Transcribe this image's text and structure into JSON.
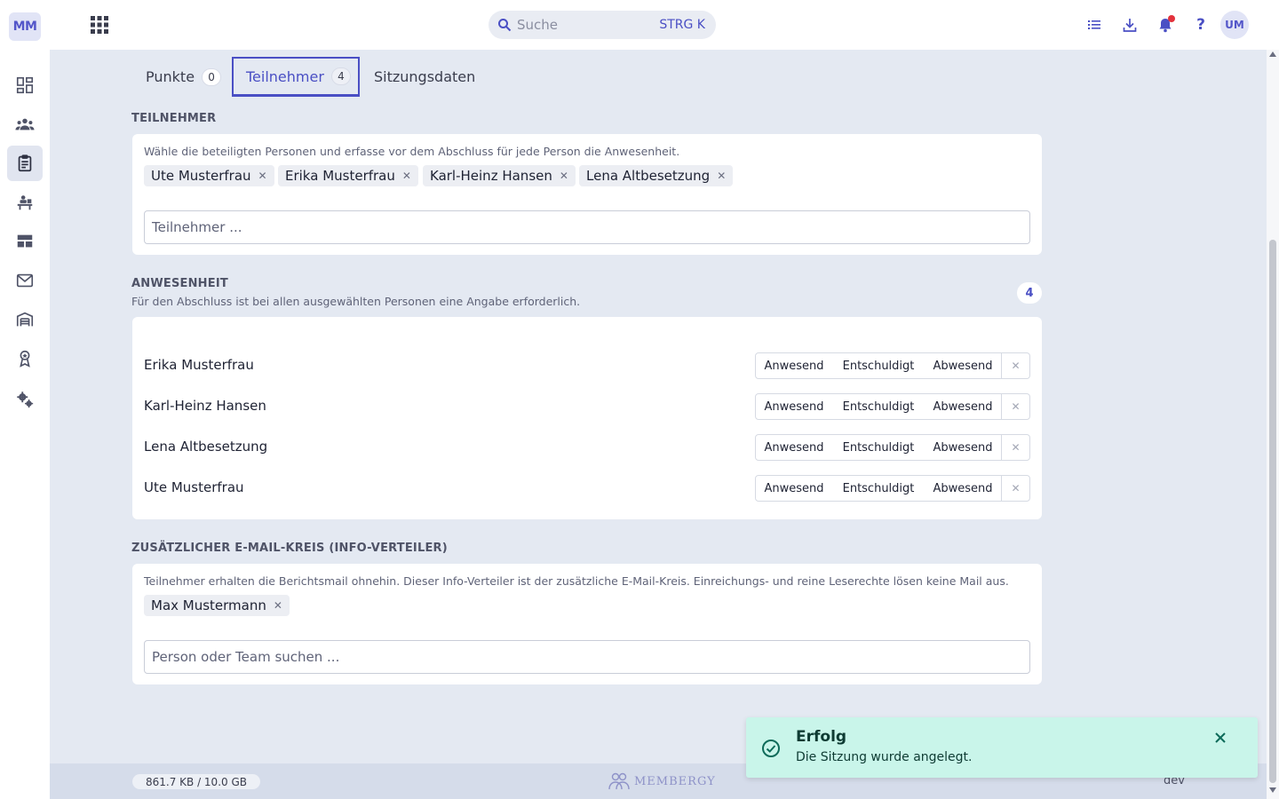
{
  "brand": {
    "initials": "MM"
  },
  "sidebar": {
    "items": [
      {
        "icon": "dashboard-icon"
      },
      {
        "icon": "people-icon"
      },
      {
        "icon": "clipboard-icon",
        "active": true
      },
      {
        "icon": "meeting-icon"
      },
      {
        "icon": "table-icon"
      },
      {
        "icon": "mail-icon"
      },
      {
        "icon": "warehouse-icon"
      },
      {
        "icon": "award-icon"
      },
      {
        "icon": "settings-icon"
      }
    ]
  },
  "topbar": {
    "search_placeholder": "Suche",
    "search_shortcut": "STRG K",
    "help_label": "?",
    "avatar_initials": "UM"
  },
  "tabs": [
    {
      "label": "Punkte",
      "count": "0"
    },
    {
      "label": "Teilnehmer",
      "count": "4",
      "active": true
    },
    {
      "label": "Sitzungsdaten"
    }
  ],
  "participants": {
    "title": "TEILNEHMER",
    "hint": "Wähle die beteiligten Personen und erfasse vor dem Abschluss für jede Person die Anwesenheit.",
    "chips": [
      "Ute Musterfrau",
      "Erika Musterfrau",
      "Karl-Heinz Hansen",
      "Lena Altbesetzung"
    ],
    "input_placeholder": "Teilnehmer ..."
  },
  "attendance": {
    "title": "ANWESENHEIT",
    "subtitle": "Für den Abschluss ist bei allen ausgewählten Personen eine Angabe erforderlich.",
    "count": "4",
    "options": [
      "Anwesend",
      "Entschuldigt",
      "Abwesend"
    ],
    "people": [
      "Erika Musterfrau",
      "Karl-Heinz Hansen",
      "Lena Altbesetzung",
      "Ute Musterfrau"
    ]
  },
  "mailing": {
    "title": "ZUSÄTZLICHER E-MAIL-KREIS (INFO-VERTEILER)",
    "hint": "Teilnehmer erhalten die Berichtsmail ohnehin. Dieser Info-Verteiler ist der zusätzliche E-Mail-Kreis. Einreichungs- und reine Leserechte lösen keine Mail aus.",
    "chips": [
      "Max Mustermann"
    ],
    "input_placeholder": "Person oder Team suchen ..."
  },
  "footer": {
    "storage": "861.7 KB / 10.0 GB",
    "logo_text": "MEMBERGY",
    "env": "dev"
  },
  "toast": {
    "title": "Erfolg",
    "message": "Die Sitzung wurde angelegt."
  },
  "colors": {
    "accent": "#4a4fc4",
    "background": "#e4e9f2",
    "toast_bg": "#c9f5ea",
    "notification": "#e3323c"
  }
}
